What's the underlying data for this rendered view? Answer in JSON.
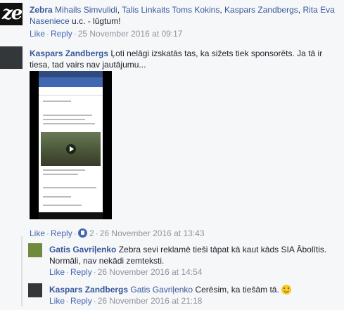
{
  "comments": [
    {
      "author": "Zebra",
      "mentions": [
        "Mihails Simvulidi",
        "Talis Linkaits",
        "Toms Kokins",
        "Kaspars Zandbergs",
        "Rita Eva Naseniece"
      ],
      "text": "u.c. - lūgtum!",
      "like_label": "Like",
      "reply_label": "Reply",
      "timestamp": "25 November 2016 at 09:17"
    },
    {
      "author": "Kaspars Zandbergs",
      "text": "Ļoti nelāgi izskatās tas, ka sižets tiek sponsorēts. Ja tā ir tiesa, tad vairs nav jautājumu...",
      "like_label": "Like",
      "reply_label": "Reply",
      "like_count": "2",
      "timestamp": "26 November 2016 at 13:43"
    }
  ],
  "replies": [
    {
      "author": "Gatis Gavriļenko",
      "text": "Zebra sevi reklamē tieši tāpat kā kaut kāds SIA Ābolītis. Normāli, nav nekādi zemteksti.",
      "like_label": "Like",
      "reply_label": "Reply",
      "timestamp": "26 November 2016 at 14:54"
    },
    {
      "author": "Kaspars Zandbergs",
      "mention": "Gatis Gavriļenko",
      "text": "Cerēsim, ka tiešām tā.",
      "like_label": "Like",
      "reply_label": "Reply",
      "timestamp": "26 November 2016 at 21:18"
    }
  ],
  "avatar_logo_text": "ze",
  "colors": {
    "link": "#365899",
    "action": "#4267b2",
    "meta": "#90949c",
    "background": "#f6f7f9"
  },
  "icons": [
    "like-icon",
    "smile-emoji-icon"
  ]
}
